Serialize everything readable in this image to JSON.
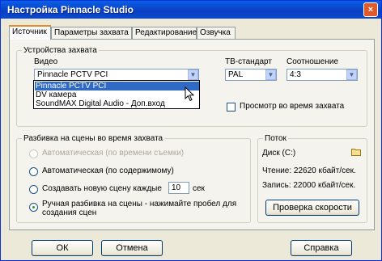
{
  "window": {
    "title": "Настройка Pinnacle Studio",
    "close_glyph": "×"
  },
  "tabs": [
    {
      "label": "Источник"
    },
    {
      "label": "Параметры захвата"
    },
    {
      "label": "Редактирование"
    },
    {
      "label": "Озвучка"
    }
  ],
  "capture_devices": {
    "legend": "Устройства захвата",
    "video_label": "Видео",
    "video_selected": "Pinnacle PCTV PCI",
    "dropdown_options": [
      "Pinnacle PCTV PCI",
      "DV камера",
      "SoundMAX Digital Audio - Доп.вход"
    ],
    "tv_standard_label": "ТВ-стандарт",
    "tv_standard_value": "PAL",
    "aspect_label": "Соотношение",
    "aspect_value": "4:3",
    "preview_checkbox_label": "Просмотр во время захвата",
    "preview_checked": false
  },
  "scene_detection": {
    "legend": "Разбивка на сцены во время захвата",
    "options": [
      {
        "label": "Автоматическая (по времени съемки)",
        "disabled": true,
        "checked": false
      },
      {
        "label": "Автоматическая (по содержимому)",
        "disabled": false,
        "checked": false
      },
      {
        "label": "Создавать новую сцену каждые",
        "disabled": false,
        "checked": false
      },
      {
        "label": "Ручная разбивка на сцены - нажимайте пробел для",
        "label_line2": "создания сцен",
        "disabled": false,
        "checked": true
      }
    ],
    "seconds_value": "10",
    "seconds_unit": "сек"
  },
  "data_rate": {
    "legend": "Поток",
    "disk_label": "Диск (C:)",
    "read_label": "Чтение: 22620 кбайт/сек.",
    "write_label": "Запись: 22000 кбайт/сек.",
    "test_button": "Проверка скорости"
  },
  "footer": {
    "ok": "ОК",
    "cancel": "Отмена",
    "help": "Справка"
  }
}
